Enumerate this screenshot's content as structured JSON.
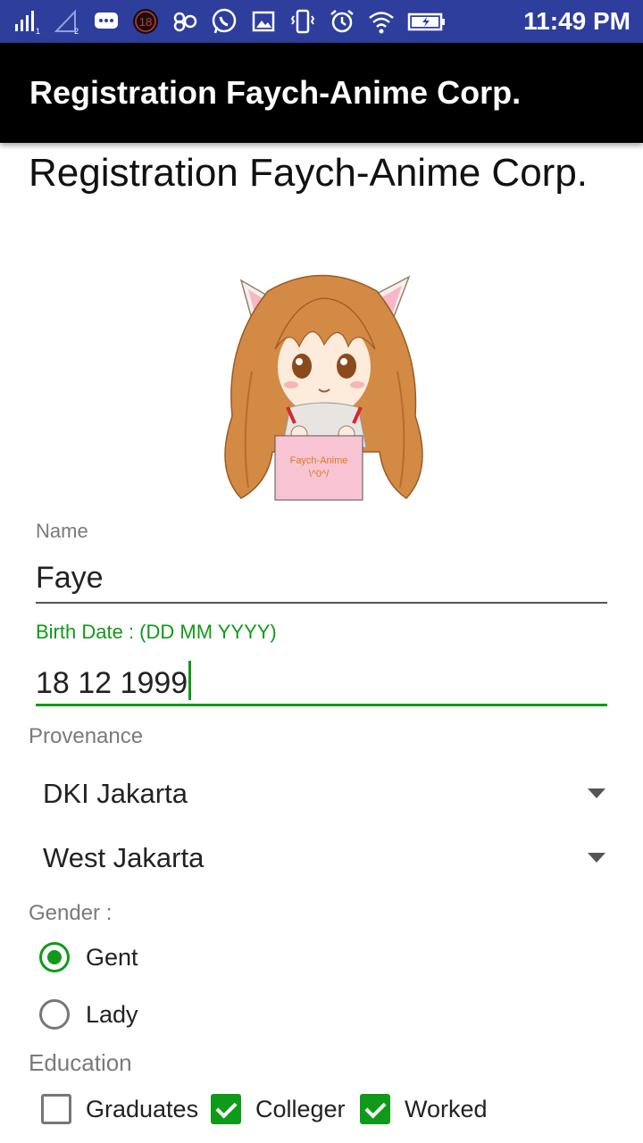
{
  "status_bar": {
    "time": "11:49 PM",
    "notification_badge": "18",
    "sim1_label": "1",
    "sim2_label": "2",
    "icons": [
      "signal-icon",
      "signal-2-icon",
      "chat-icon",
      "badge-icon",
      "infinity-icon",
      "whatsapp-icon",
      "image-icon",
      "vibrate-icon",
      "alarm-icon",
      "wifi-icon",
      "battery-charging-icon"
    ]
  },
  "app_bar": {
    "title": "Registration Faych-Anime Corp."
  },
  "page": {
    "title": "Registration Faych-Anime Corp."
  },
  "mascot": {
    "sign_line1": "Faych-Anime",
    "sign_line2": "\\^0^/"
  },
  "form": {
    "name": {
      "label": "Name",
      "value": "Faye"
    },
    "birth_date": {
      "label": "Birth Date : (DD MM YYYY)",
      "value": "18 12 1999"
    },
    "provenance": {
      "label": "Provenance",
      "province": "DKI Jakarta",
      "city": "West Jakarta"
    },
    "gender": {
      "label": "Gender :",
      "options": [
        {
          "label": "Gent",
          "checked": true
        },
        {
          "label": "Lady",
          "checked": false
        }
      ]
    },
    "education": {
      "label": "Education",
      "options": [
        {
          "label": "Graduates",
          "checked": false
        },
        {
          "label": "Colleger",
          "checked": true
        },
        {
          "label": "Worked",
          "checked": true
        }
      ]
    }
  },
  "colors": {
    "status_bar": "#2d3e9c",
    "app_bar": "#000000",
    "accent": "#109a1a"
  }
}
